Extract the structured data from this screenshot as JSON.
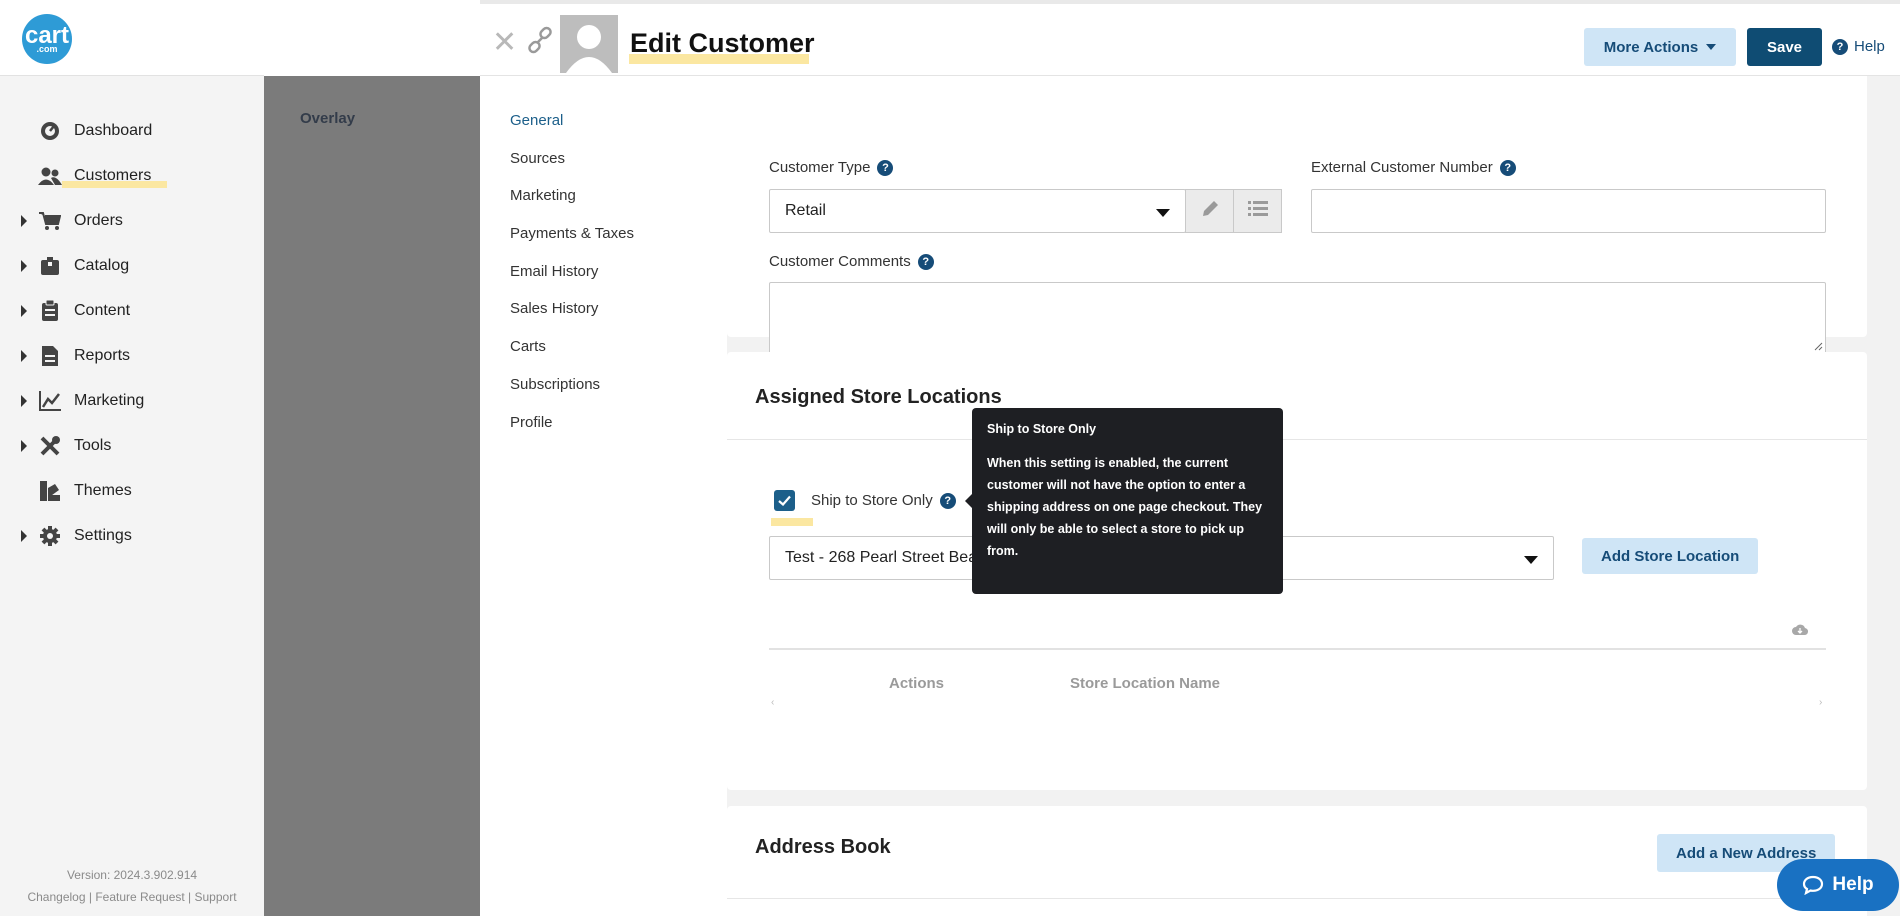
{
  "brand": {
    "logo_text": "cart",
    "logo_sub": ".com"
  },
  "sidebar": {
    "items": [
      {
        "label": "Dashboard",
        "icon": "dashboard-icon",
        "expandable": false
      },
      {
        "label": "Customers",
        "icon": "users-icon",
        "expandable": false,
        "active": true
      },
      {
        "label": "Orders",
        "icon": "cart-icon",
        "expandable": true
      },
      {
        "label": "Catalog",
        "icon": "box-icon",
        "expandable": true
      },
      {
        "label": "Content",
        "icon": "clipboard-icon",
        "expandable": true
      },
      {
        "label": "Reports",
        "icon": "document-icon",
        "expandable": true
      },
      {
        "label": "Marketing",
        "icon": "chart-icon",
        "expandable": true
      },
      {
        "label": "Tools",
        "icon": "tools-icon",
        "expandable": true
      },
      {
        "label": "Themes",
        "icon": "palette-icon",
        "expandable": false
      },
      {
        "label": "Settings",
        "icon": "gear-icon",
        "expandable": true
      }
    ],
    "version": "Version: 2024.3.902.914",
    "footer_links": [
      "Changelog",
      "Feature Request",
      "Support"
    ],
    "footer_sep": " | "
  },
  "overlay": {
    "label": "Overlay"
  },
  "header": {
    "title": "Edit Customer",
    "more_actions": "More Actions",
    "save": "Save",
    "help": "Help"
  },
  "subnav": {
    "items": [
      "General",
      "Sources",
      "Marketing",
      "Payments & Taxes",
      "Email History",
      "Sales History",
      "Carts",
      "Subscriptions",
      "Profile"
    ],
    "active": "General"
  },
  "general": {
    "customer_type_label": "Customer Type",
    "customer_type_value": "Retail",
    "external_number_label": "External Customer Number",
    "external_number_value": "",
    "comments_label": "Customer Comments",
    "comments_value": ""
  },
  "store_locations": {
    "title": "Assigned Store Locations",
    "ship_to_store_label": "Ship to Store Only",
    "ship_to_store_checked": true,
    "selected_location": "Test - 268 Pearl Street Bea",
    "add_button": "Add Store Location",
    "columns": [
      "Actions",
      "Store Location Name"
    ]
  },
  "tooltip": {
    "title": "Ship to Store Only",
    "body": "When this setting is enabled, the current customer will not have the option to enter a shipping address on one page checkout. They will only be able to select a store to pick up from."
  },
  "address_book": {
    "title": "Address Book",
    "add_button": "Add a New Address"
  },
  "floating_help": {
    "label": "Help"
  },
  "colors": {
    "primary": "#0f4c73",
    "light_button": "#cfe5f6",
    "highlight": "#fbe7a1",
    "overlay": "#7b7b7b"
  }
}
